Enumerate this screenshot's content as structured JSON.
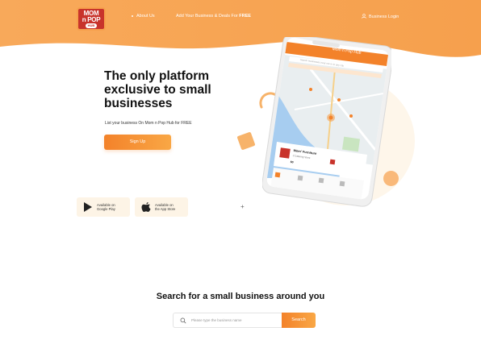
{
  "header": {
    "logo": {
      "line1": "MOM",
      "line2": "n POP",
      "badge": "HUB"
    },
    "nav": {
      "about": "About Us",
      "add_business_prefix": "Add Your Business & Deals For",
      "add_business_free": "FREE",
      "login": "Business Login"
    }
  },
  "hero": {
    "title": "The only platform exclusive to small businesses",
    "subtitle": "List your business On Mom n Pop Hub for FREE",
    "signup_label": "Sign Up",
    "stores": [
      {
        "line1": "Available on",
        "line2": "Google Play",
        "icon": "google-play-icon"
      },
      {
        "line1": "Available on",
        "line2": "the App Store",
        "icon": "apple-icon"
      }
    ]
  },
  "phone": {
    "app_title": "Mom n Pop Hub",
    "search_placeholder": "Search businesses near me or in any city",
    "card_title": "Mom' Furniture",
    "card_line": "2 Catering Store",
    "card_price": "$0"
  },
  "search": {
    "title": "Search for a small business around you",
    "placeholder": "Please type the business name",
    "button_label": "Search"
  },
  "colors": {
    "brand_orange": "#f3822a",
    "brand_orange_light": "#f9a745",
    "logo_red": "#c8332b"
  }
}
